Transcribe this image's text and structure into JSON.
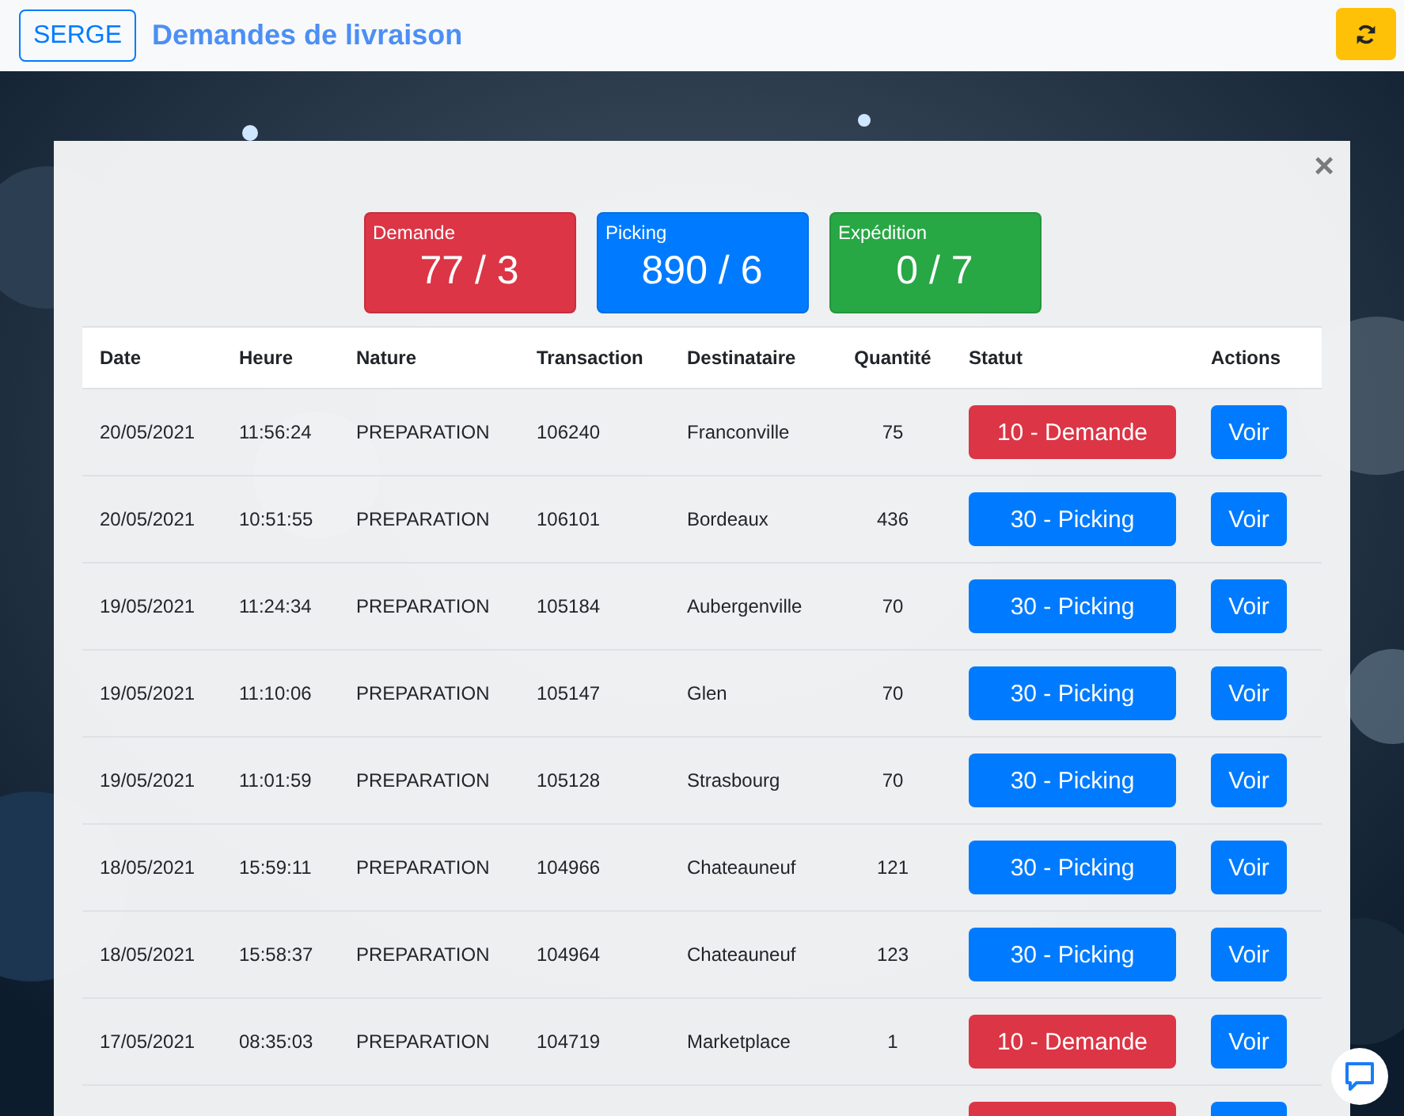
{
  "header": {
    "user_button": "SERGE",
    "title": "Demandes de livraison"
  },
  "modal": {
    "close": "×",
    "summary_cards": [
      {
        "kind": "demande",
        "label": "Demande",
        "value": "77 / 3"
      },
      {
        "kind": "picking",
        "label": "Picking",
        "value": "890 / 6"
      },
      {
        "kind": "expedition",
        "label": "Expédition",
        "value": "0 / 7"
      }
    ],
    "table": {
      "columns": [
        "Date",
        "Heure",
        "Nature",
        "Transaction",
        "Destinataire",
        "Quantité",
        "Statut",
        "Actions"
      ],
      "rows": [
        {
          "date": "20/05/2021",
          "time": "11:56:24",
          "nature": "PREPARATION",
          "transaction": "106240",
          "recipient": "Franconville",
          "quantity": "75",
          "status": "10 - Demande",
          "kind": "demande",
          "action": "Voir"
        },
        {
          "date": "20/05/2021",
          "time": "10:51:55",
          "nature": "PREPARATION",
          "transaction": "106101",
          "recipient": "Bordeaux",
          "quantity": "436",
          "status": "30 - Picking",
          "kind": "picking",
          "action": "Voir"
        },
        {
          "date": "19/05/2021",
          "time": "11:24:34",
          "nature": "PREPARATION",
          "transaction": "105184",
          "recipient": "Aubergenville",
          "quantity": "70",
          "status": "30 - Picking",
          "kind": "picking",
          "action": "Voir"
        },
        {
          "date": "19/05/2021",
          "time": "11:10:06",
          "nature": "PREPARATION",
          "transaction": "105147",
          "recipient": "Glen",
          "quantity": "70",
          "status": "30 - Picking",
          "kind": "picking",
          "action": "Voir"
        },
        {
          "date": "19/05/2021",
          "time": "11:01:59",
          "nature": "PREPARATION",
          "transaction": "105128",
          "recipient": "Strasbourg",
          "quantity": "70",
          "status": "30 - Picking",
          "kind": "picking",
          "action": "Voir"
        },
        {
          "date": "18/05/2021",
          "time": "15:59:11",
          "nature": "PREPARATION",
          "transaction": "104966",
          "recipient": "Chateauneuf",
          "quantity": "121",
          "status": "30 - Picking",
          "kind": "picking",
          "action": "Voir"
        },
        {
          "date": "18/05/2021",
          "time": "15:58:37",
          "nature": "PREPARATION",
          "transaction": "104964",
          "recipient": "Chateauneuf",
          "quantity": "123",
          "status": "30 - Picking",
          "kind": "picking",
          "action": "Voir"
        },
        {
          "date": "17/05/2021",
          "time": "08:35:03",
          "nature": "PREPARATION",
          "transaction": "104719",
          "recipient": "Marketplace",
          "quantity": "1",
          "status": "10 - Demande",
          "kind": "demande",
          "action": "Voir"
        }
      ],
      "partial_row": {
        "kind": "demande"
      }
    }
  }
}
